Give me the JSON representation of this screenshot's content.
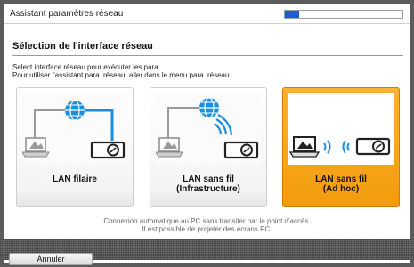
{
  "window": {
    "title": "Assistant paramètres réseau",
    "progress_fraction": 0.12
  },
  "header": {
    "title": "Sélection de l'interface réseau",
    "instructions": [
      "Select interface réseau pour exécuter les para.",
      "Pour utiliser l'assistant para. réseau, aller dans le menu para. réseau."
    ]
  },
  "options": [
    {
      "label_line1": "LAN filaire",
      "label_line2": "",
      "selected": false
    },
    {
      "label_line1": "LAN sans fil",
      "label_line2": "(Infrastructure)",
      "selected": false
    },
    {
      "label_line1": "LAN sans fil",
      "label_line2": "(Ad hoc)",
      "selected": true
    }
  ],
  "caption": {
    "line1": "Connexion automatique au PC sans transiter par le point d'accès.",
    "line2": "Il est possible de projeter des écrans PC."
  },
  "footer": {
    "cancel_label": "Annuler"
  },
  "colors": {
    "accent_blue": "#1a5fd0",
    "selected_orange": "#f49b0c",
    "globe_blue": "#1a8fe0"
  }
}
